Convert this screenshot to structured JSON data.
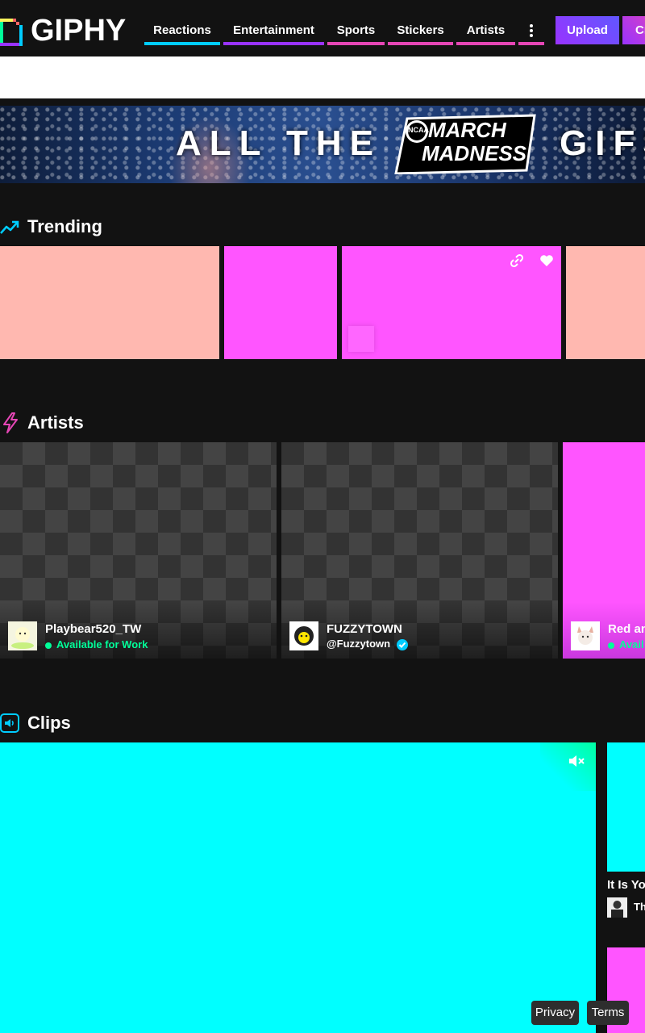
{
  "brand": {
    "name": "GIPHY"
  },
  "nav": {
    "items": [
      {
        "label": "Reactions",
        "color": "#00ccff"
      },
      {
        "label": "Entertainment",
        "color": "#9933ff"
      },
      {
        "label": "Sports",
        "color": "#e646b6"
      },
      {
        "label": "Stickers",
        "color": "#e646b6"
      },
      {
        "label": "Artists",
        "color": "#e646b6"
      }
    ],
    "more_icon": "more-vertical-icon",
    "upload_label": "Upload",
    "create_label": "Cr"
  },
  "banner": {
    "left_text": "ALL THE",
    "right_text": "GIFS",
    "logo_line1": "MARCH",
    "logo_line2": "MADNESS",
    "logo_badge": "NCAA"
  },
  "trending": {
    "title": "Trending",
    "icon": "trending-up-icon",
    "tile_colors": [
      "#ffb8b0",
      "#ff55ff",
      "#ff55ff",
      "#ffb8b0"
    ]
  },
  "artists": {
    "title": "Artists",
    "icon": "lightning-icon",
    "cards": [
      {
        "name": "Playbear520_TW",
        "subtitle": "Available for Work"
      },
      {
        "name": "FUZZYTOWN",
        "subtitle": "@Fuzzytown"
      },
      {
        "name": "Red an",
        "subtitle": "Avail"
      }
    ]
  },
  "clips": {
    "title": "Clips",
    "icon": "speaker-icon",
    "main_clip_color": "#00ffff",
    "side_clip_title": "It Is Yo",
    "side_clip_user": "Th"
  },
  "footer": {
    "privacy": "Privacy",
    "terms": "Terms"
  }
}
